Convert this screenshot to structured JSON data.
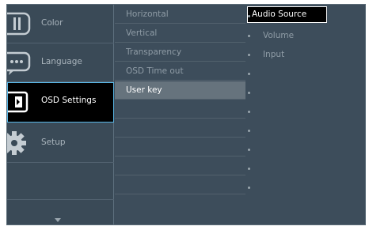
{
  "categories": [
    {
      "label": "Color",
      "icon": "color-icon"
    },
    {
      "label": "Language",
      "icon": "language-icon"
    },
    {
      "label": "OSD Settings",
      "icon": "osd-settings-icon",
      "selected": true
    },
    {
      "label": "Setup",
      "icon": "setup-icon"
    }
  ],
  "submenu": [
    {
      "label": "Horizontal"
    },
    {
      "label": "Vertical"
    },
    {
      "label": "Transparency"
    },
    {
      "label": "OSD Time out"
    },
    {
      "label": "User key",
      "active": true
    }
  ],
  "options": [
    {
      "label": "Audio Source",
      "selected": true
    },
    {
      "label": "Volume"
    },
    {
      "label": "Input"
    }
  ],
  "icons": {
    "scroll": "chevron-down-icon"
  },
  "colors": {
    "background": "#3d4d5b",
    "selected_category": "#000000",
    "selected_border": "#5ab8e8",
    "active_submenu": "#66737d",
    "text": "#8f9ca6",
    "text_selected": "#ffffff"
  }
}
